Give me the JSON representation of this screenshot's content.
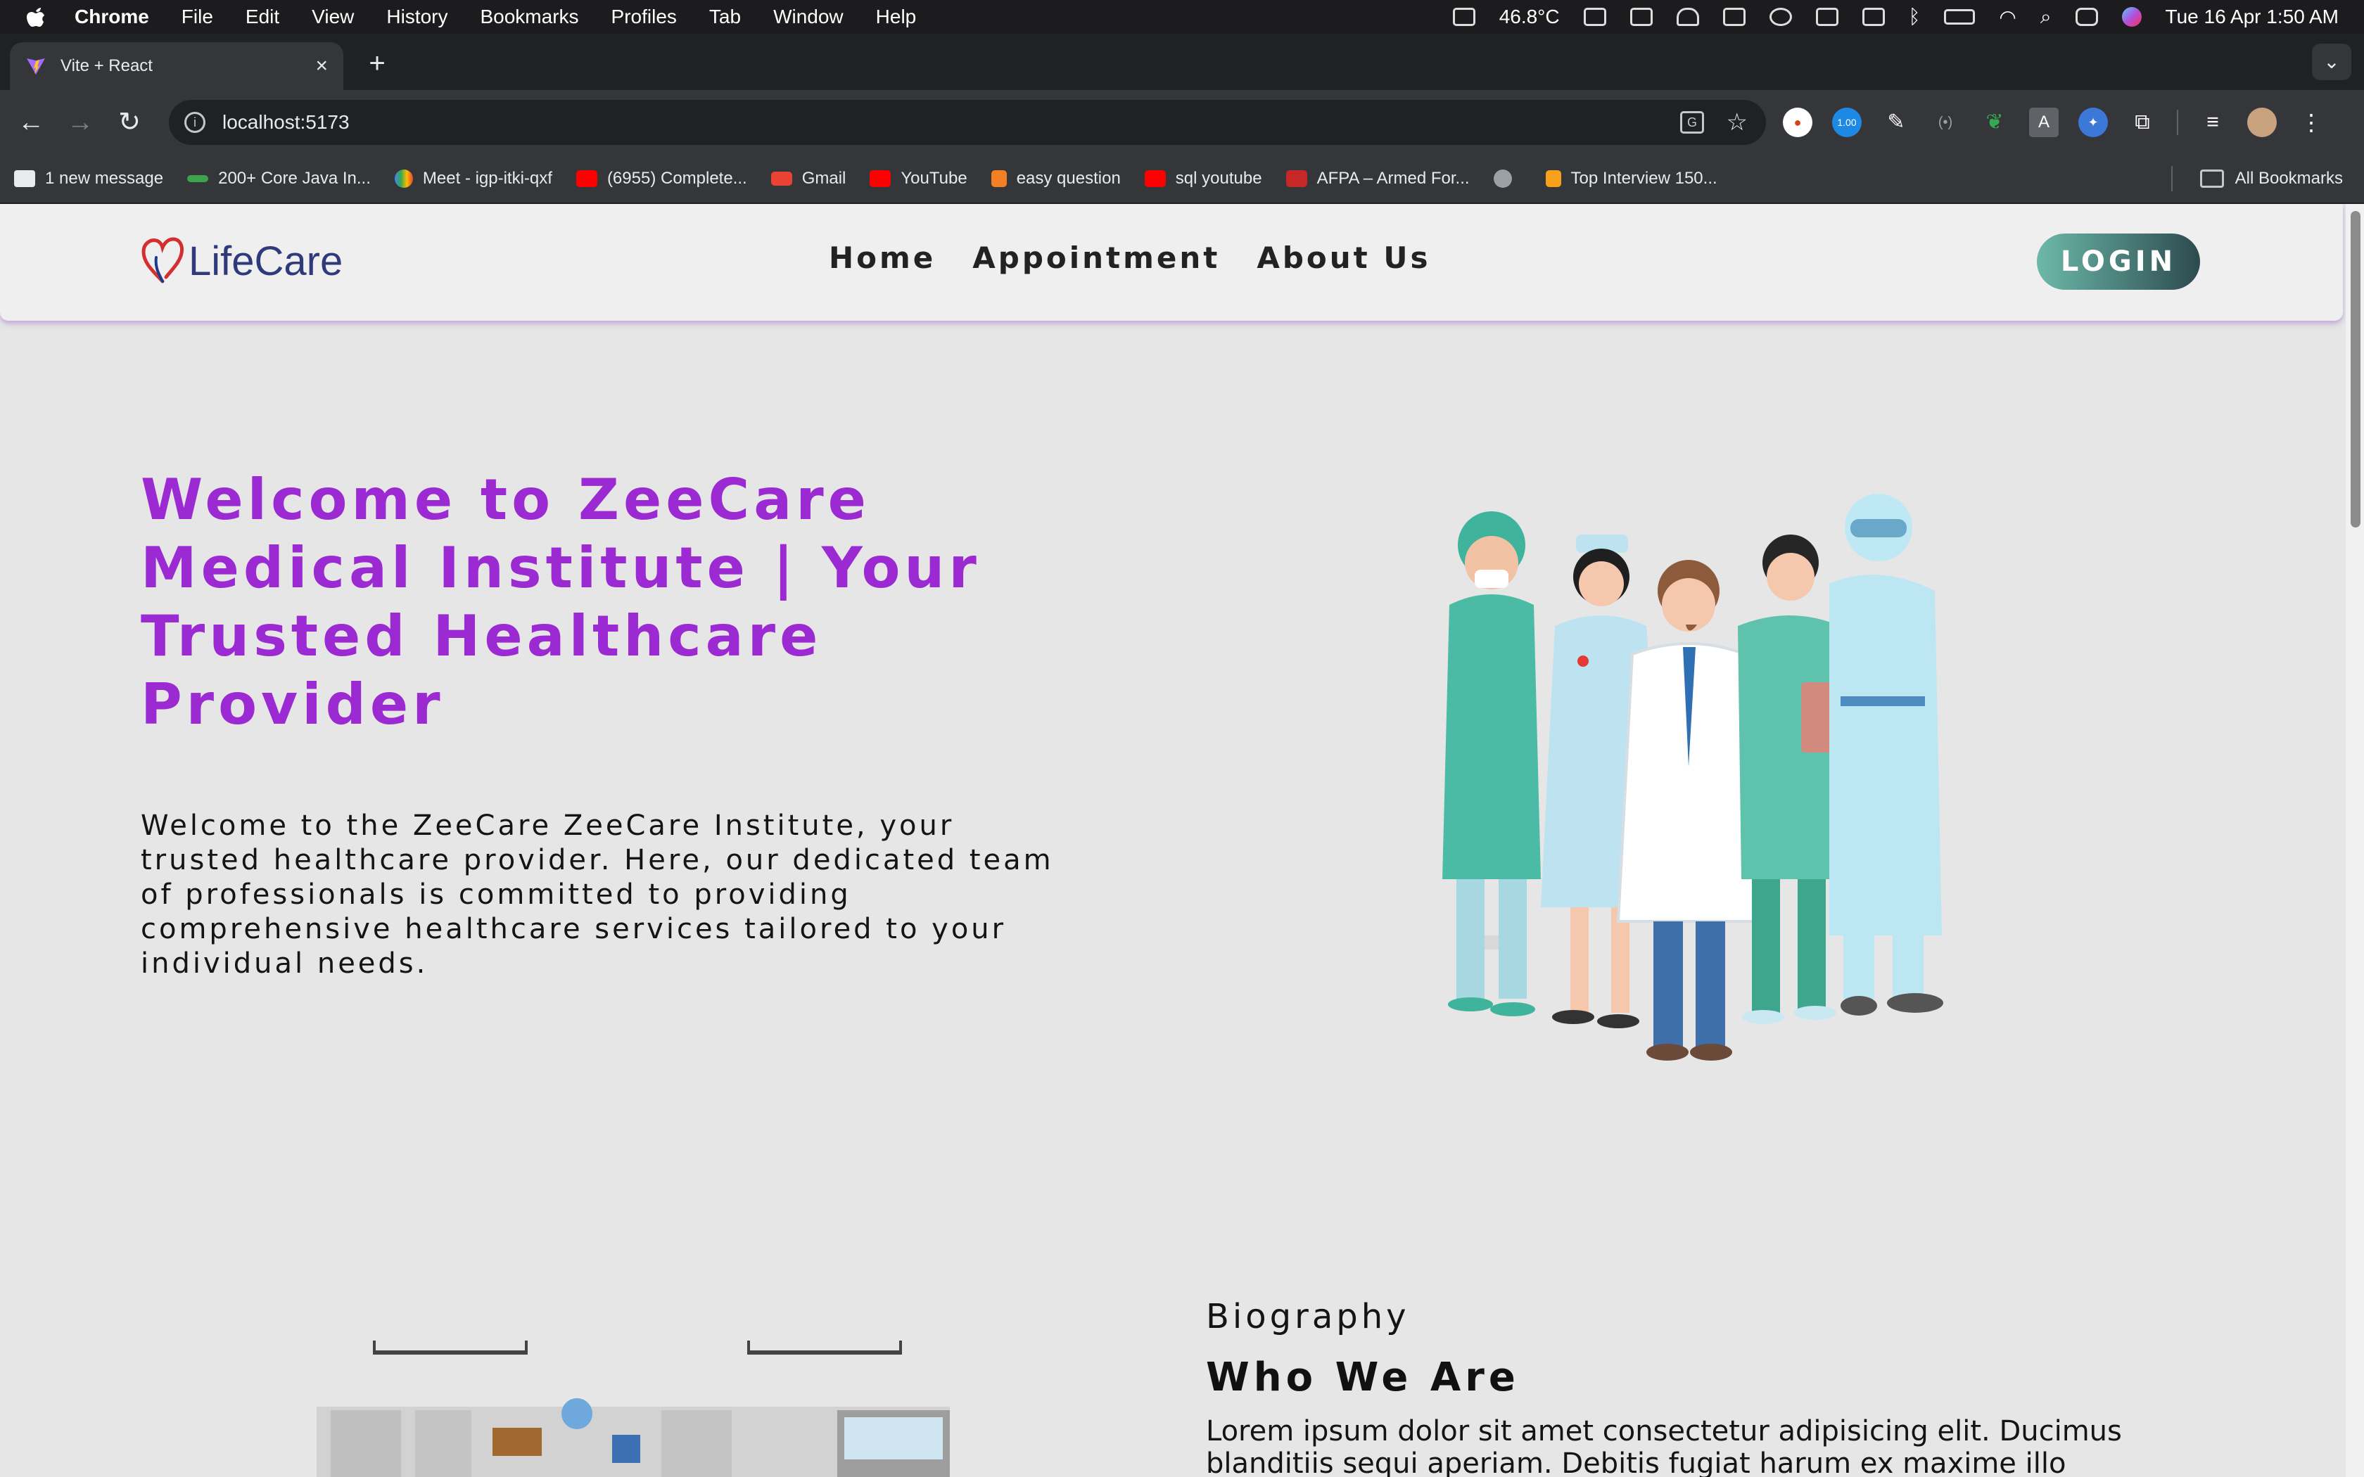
{
  "menubar": {
    "app_name": "Chrome",
    "items": [
      "File",
      "Edit",
      "View",
      "History",
      "Bookmarks",
      "Profiles",
      "Tab",
      "Window",
      "Help"
    ],
    "temperature": "46.8°C",
    "datetime": "Tue 16 Apr  1:50 AM"
  },
  "browser": {
    "tab_title": "Vite + React",
    "url": "localhost:5173",
    "extension_badge": "1.00",
    "bookmarks": [
      {
        "label": "1 new message",
        "icon": "wordpress-icon",
        "color": "#e8eaed"
      },
      {
        "label": "200+ Core Java In...",
        "icon": "link-icon",
        "color": "#3ca44a"
      },
      {
        "label": "Meet - igp-itki-qxf",
        "icon": "meet-icon",
        "color": "#00897b"
      },
      {
        "label": "(6955) Complete...",
        "icon": "youtube-icon",
        "color": "#ff0000"
      },
      {
        "label": "Gmail",
        "icon": "gmail-icon",
        "color": "#ea4335"
      },
      {
        "label": "YouTube",
        "icon": "youtube-icon",
        "color": "#ff0000"
      },
      {
        "label": "easy question",
        "icon": "stack-icon",
        "color": "#f48024"
      },
      {
        "label": "sql youtube",
        "icon": "youtube-icon",
        "color": "#ff0000"
      },
      {
        "label": "AFPA – Armed For...",
        "icon": "afpa-icon",
        "color": "#c62828"
      },
      {
        "label": "",
        "icon": "globe-icon",
        "color": "#9aa0a6"
      },
      {
        "label": "Top Interview 150...",
        "icon": "leetcode-icon",
        "color": "#f89f1b"
      }
    ],
    "all_bookmarks_label": "All Bookmarks"
  },
  "site": {
    "logo_text": "LifeCare",
    "nav_links": [
      "Home",
      "Appointment",
      "About Us"
    ],
    "login_label": "LOGIN",
    "accent_color": "#9b2ad3"
  },
  "hero": {
    "title": "Welcome to ZeeCare Medical Institute | Your Trusted Healthcare Provider",
    "description": "Welcome to the ZeeCare ZeeCare Institute, your trusted healthcare provider. Here, our dedicated team of professionals is committed to providing comprehensive healthcare services tailored to your individual needs."
  },
  "biography": {
    "label": "Biography",
    "title": "Who We Are",
    "text": "Lorem ipsum dolor sit amet consectetur adipisicing elit. Ducimus blanditiis sequi aperiam. Debitis fugiat harum ex maxime illo"
  }
}
